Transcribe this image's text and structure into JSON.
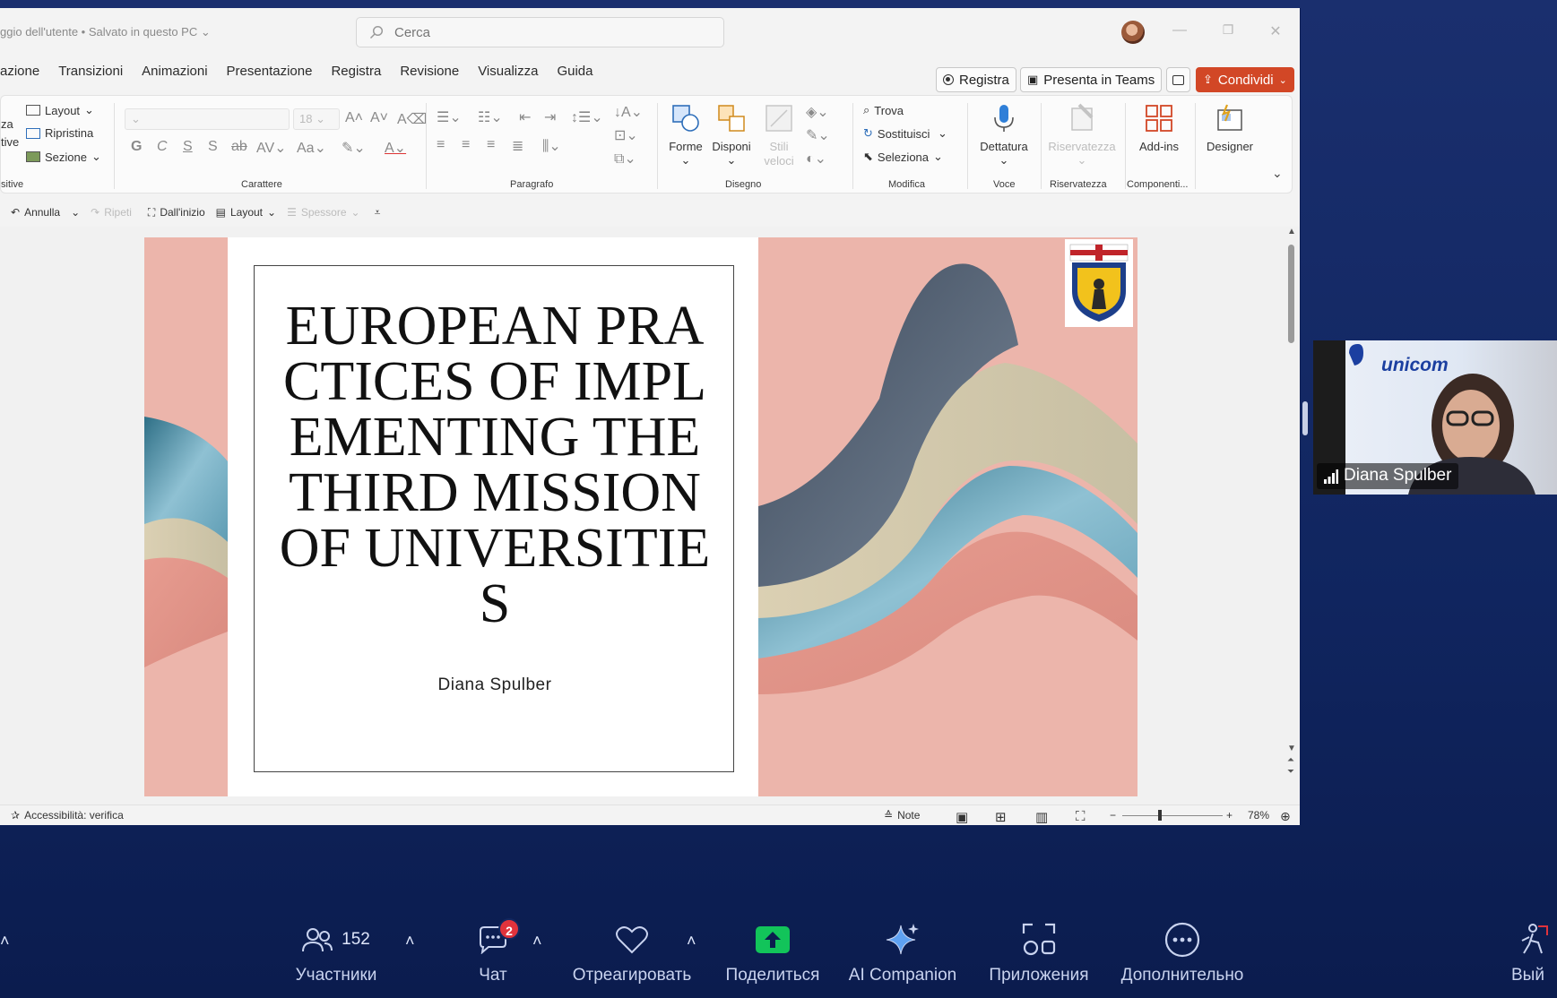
{
  "window": {
    "doc_title": "ggio dell'utente • Salvato in questo PC",
    "search_placeholder": "Cerca",
    "minimize": "—",
    "restore": "❐",
    "close": "✕"
  },
  "menu": [
    "azione",
    "Transizioni",
    "Animazioni",
    "Presentazione",
    "Registra",
    "Revisione",
    "Visualizza",
    "Guida"
  ],
  "right_buttons": {
    "record": "Registra",
    "teams": "Presenta in Teams",
    "share": "Condividi"
  },
  "ribbon": {
    "slides": {
      "layout": "Layout",
      "reset": "Ripristina",
      "section": "Sezione",
      "cut_a": "za",
      "cut_b": "tive",
      "label": "sitive"
    },
    "font": {
      "size": "18",
      "label": "Carattere",
      "bold": "G",
      "italic": "C",
      "underline": "S",
      "shadow": "S"
    },
    "paragraph": {
      "label": "Paragrafo"
    },
    "drawing": {
      "shapes": "Forme",
      "arrange": "Disponi",
      "quick_styles": "Stili veloci",
      "label": "Disegno"
    },
    "edit": {
      "find": "Trova",
      "replace": "Sostituisci",
      "select": "Seleziona",
      "label": "Modifica"
    },
    "voice": {
      "dictate": "Dettatura",
      "label": "Voce"
    },
    "privacy": {
      "sensitivity": "Riservatezza",
      "label": "Riservatezza"
    },
    "addins": {
      "addins": "Add-ins",
      "label": "Componenti..."
    },
    "designer": {
      "designer": "Designer"
    }
  },
  "qat": {
    "undo": "Annulla",
    "redo": "Ripeti",
    "from_start": "Dall'inizio",
    "layout": "Layout",
    "thickness": "Spessore"
  },
  "slide": {
    "title": "EUROPEAN PRACTICES OF IMPLEMENTING THE THIRD MISSION OF UNIVERSITIES",
    "author": "Diana Spulber"
  },
  "status": {
    "accessibility": "Accessibilità: verifica",
    "notes": "Note",
    "zoom": "78%"
  },
  "video": {
    "name": "Diana Spulber",
    "logo_text": "unicom"
  },
  "zoom_toolbar": {
    "participants_count": "152",
    "participants": "Участники",
    "chat": "Чат",
    "chat_badge": "2",
    "react": "Отреагировать",
    "share": "Поделиться",
    "ai": "AI Companion",
    "apps": "Приложения",
    "more": "Дополнительно",
    "leave": "Вый"
  },
  "colors": {
    "share_red": "#d24726",
    "slide_pink": "#ecb5ab",
    "zoom_bg": "#10255f",
    "share_green": "#12c45a"
  }
}
